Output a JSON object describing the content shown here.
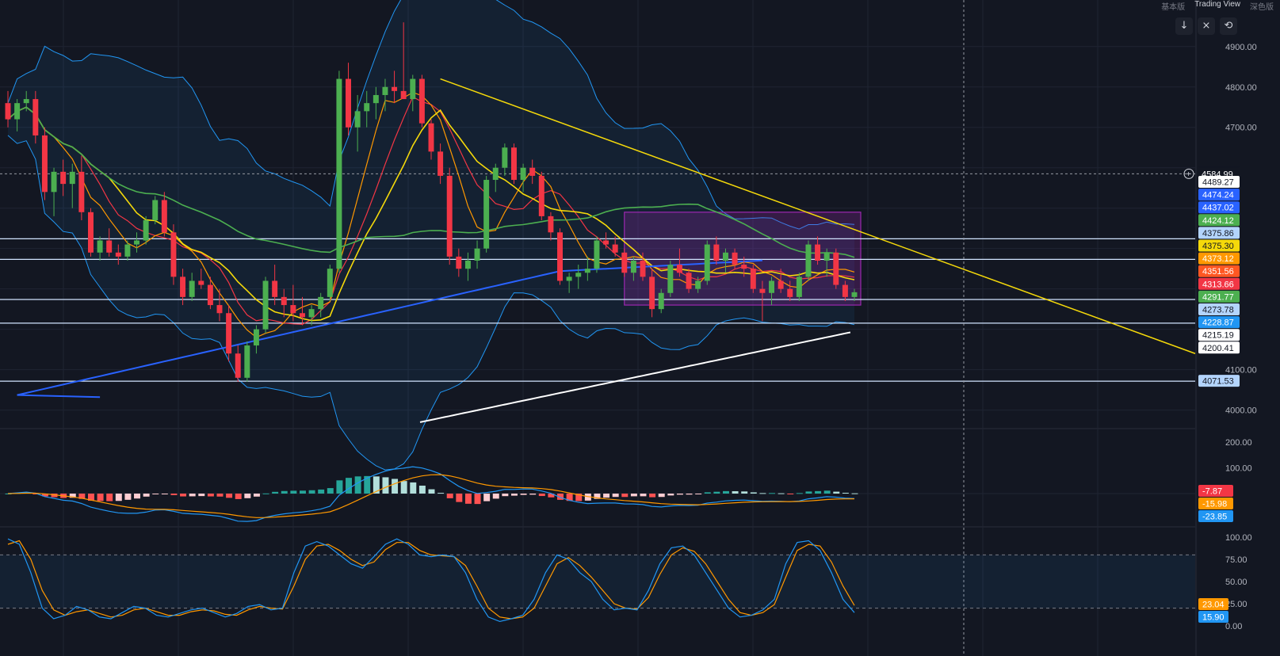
{
  "toolbar": {
    "buttons": [
      {
        "name": "scroll-down-button",
        "glyph": "↓"
      },
      {
        "name": "collapse-button",
        "glyph": "⨯"
      },
      {
        "name": "reset-button",
        "glyph": "⟲"
      }
    ],
    "brand_items": [
      "基本版",
      "Trading View",
      "深色版"
    ]
  },
  "colors": {
    "background": "#131722",
    "grid": "#1f2433",
    "up": "#4caf50",
    "down": "#f23645",
    "ma_yellow": "#f5d90a",
    "ma_orange": "#ff9800",
    "ma_green": "#4caf50",
    "ma_blue": "#2962ff",
    "ma_white": "#ffffff",
    "bollinger": "#2196f3",
    "trendline": "#f5d90a",
    "range_box": "#9c27b0"
  },
  "chart_data": [
    {
      "type": "candlestick",
      "panel": "price",
      "ylim": [
        3960,
        4980
      ],
      "y_ticks": [
        "4900.00",
        "4800.00",
        "4700.00",
        "4584.99",
        "4100.00",
        "4000.00"
      ],
      "crosshair_price": "4584.99",
      "horizontal_levels": [
        4424.12,
        4373.12,
        4273.78,
        4215.19,
        4071.53
      ],
      "price_labels": [
        {
          "value": "4489.27",
          "color": "#ffffff",
          "text_color": "#131722"
        },
        {
          "value": "4474.24",
          "color": "#2962ff",
          "text_color": "#ffffff"
        },
        {
          "value": "4437.02",
          "color": "#2962ff",
          "text_color": "#ffffff"
        },
        {
          "value": "4424.12",
          "color": "#4caf50",
          "text_color": "#ffffff"
        },
        {
          "value": "4375.86",
          "color": "#b3d4fc",
          "text_color": "#131722"
        },
        {
          "value": "4375.30",
          "color": "#f5d90a",
          "text_color": "#131722"
        },
        {
          "value": "4373.12",
          "color": "#ff9800",
          "text_color": "#ffffff"
        },
        {
          "value": "4351.56",
          "color": "#ff5722",
          "text_color": "#ffffff"
        },
        {
          "value": "4313.66",
          "color": "#f23645",
          "text_color": "#ffffff"
        },
        {
          "value": "4291.77",
          "color": "#4caf50",
          "text_color": "#ffffff"
        },
        {
          "value": "4273.78",
          "color": "#b3d4fc",
          "text_color": "#131722"
        },
        {
          "value": "4228.87",
          "color": "#2196f3",
          "text_color": "#ffffff"
        },
        {
          "value": "4215.19",
          "color": "#ffffff",
          "text_color": "#131722"
        },
        {
          "value": "4200.41",
          "color": "#ffffff",
          "text_color": "#131722"
        },
        {
          "value": "4071.53",
          "color": "#b3d4fc",
          "text_color": "#131722"
        }
      ],
      "ohlc": [
        [
          4760,
          4790,
          4700,
          4720
        ],
        [
          4720,
          4770,
          4690,
          4760
        ],
        [
          4760,
          4790,
          4740,
          4770
        ],
        [
          4770,
          4790,
          4660,
          4680
        ],
        [
          4680,
          4700,
          4520,
          4540
        ],
        [
          4540,
          4600,
          4480,
          4590
        ],
        [
          4590,
          4620,
          4530,
          4560
        ],
        [
          4560,
          4610,
          4500,
          4590
        ],
        [
          4590,
          4630,
          4470,
          4490
        ],
        [
          4490,
          4500,
          4380,
          4390
        ],
        [
          4390,
          4430,
          4370,
          4420
        ],
        [
          4420,
          4450,
          4380,
          4390
        ],
        [
          4390,
          4410,
          4360,
          4380
        ],
        [
          4380,
          4420,
          4370,
          4410
        ],
        [
          4410,
          4440,
          4390,
          4420
        ],
        [
          4420,
          4480,
          4410,
          4470
        ],
        [
          4470,
          4530,
          4460,
          4520
        ],
        [
          4520,
          4540,
          4430,
          4440
        ],
        [
          4440,
          4460,
          4310,
          4330
        ],
        [
          4330,
          4350,
          4260,
          4280
        ],
        [
          4280,
          4340,
          4270,
          4320
        ],
        [
          4320,
          4350,
          4300,
          4310
        ],
        [
          4310,
          4330,
          4250,
          4260
        ],
        [
          4260,
          4300,
          4220,
          4240
        ],
        [
          4240,
          4260,
          4120,
          4140
        ],
        [
          4140,
          4160,
          4070,
          4080
        ],
        [
          4080,
          4170,
          4070,
          4160
        ],
        [
          4160,
          4210,
          4140,
          4200
        ],
        [
          4200,
          4330,
          4190,
          4320
        ],
        [
          4320,
          4360,
          4260,
          4280
        ],
        [
          4280,
          4300,
          4230,
          4260
        ],
        [
          4260,
          4310,
          4220,
          4240
        ],
        [
          4240,
          4280,
          4210,
          4230
        ],
        [
          4230,
          4260,
          4210,
          4250
        ],
        [
          4250,
          4290,
          4230,
          4280
        ],
        [
          4280,
          4360,
          4270,
          4350
        ],
        [
          4350,
          4840,
          4340,
          4820
        ],
        [
          4820,
          4860,
          4680,
          4700
        ],
        [
          4700,
          4780,
          4640,
          4740
        ],
        [
          4740,
          4790,
          4700,
          4760
        ],
        [
          4760,
          4800,
          4720,
          4780
        ],
        [
          4780,
          4820,
          4740,
          4800
        ],
        [
          4800,
          4840,
          4760,
          4790
        ],
        [
          4790,
          4960,
          4770,
          4770
        ],
        [
          4770,
          4830,
          4740,
          4820
        ],
        [
          4820,
          4830,
          4700,
          4710
        ],
        [
          4710,
          4720,
          4620,
          4640
        ],
        [
          4640,
          4660,
          4560,
          4580
        ],
        [
          4580,
          4600,
          4360,
          4380
        ],
        [
          4380,
          4400,
          4330,
          4350
        ],
        [
          4350,
          4390,
          4320,
          4370
        ],
        [
          4370,
          4420,
          4350,
          4400
        ],
        [
          4400,
          4580,
          4390,
          4570
        ],
        [
          4570,
          4610,
          4540,
          4600
        ],
        [
          4600,
          4660,
          4580,
          4650
        ],
        [
          4650,
          4660,
          4560,
          4570
        ],
        [
          4570,
          4610,
          4540,
          4600
        ],
        [
          4600,
          4620,
          4560,
          4580
        ],
        [
          4580,
          4590,
          4470,
          4480
        ],
        [
          4480,
          4490,
          4420,
          4440
        ],
        [
          4440,
          4450,
          4310,
          4320
        ],
        [
          4320,
          4340,
          4290,
          4330
        ],
        [
          4330,
          4360,
          4300,
          4340
        ],
        [
          4340,
          4380,
          4320,
          4350
        ],
        [
          4350,
          4430,
          4340,
          4420
        ],
        [
          4420,
          4440,
          4400,
          4410
        ],
        [
          4410,
          4430,
          4380,
          4390
        ],
        [
          4390,
          4400,
          4330,
          4340
        ],
        [
          4340,
          4380,
          4320,
          4370
        ],
        [
          4370,
          4390,
          4320,
          4330
        ],
        [
          4330,
          4350,
          4230,
          4250
        ],
        [
          4250,
          4300,
          4240,
          4290
        ],
        [
          4290,
          4370,
          4280,
          4360
        ],
        [
          4360,
          4400,
          4330,
          4340
        ],
        [
          4340,
          4350,
          4290,
          4300
        ],
        [
          4300,
          4330,
          4290,
          4320
        ],
        [
          4320,
          4420,
          4310,
          4410
        ],
        [
          4410,
          4430,
          4360,
          4370
        ],
        [
          4370,
          4400,
          4340,
          4390
        ],
        [
          4390,
          4400,
          4350,
          4360
        ],
        [
          4360,
          4380,
          4330,
          4350
        ],
        [
          4350,
          4360,
          4290,
          4300
        ],
        [
          4300,
          4320,
          4220,
          4290
        ],
        [
          4290,
          4330,
          4260,
          4320
        ],
        [
          4320,
          4350,
          4290,
          4300
        ],
        [
          4300,
          4320,
          4270,
          4280
        ],
        [
          4280,
          4340,
          4270,
          4330
        ],
        [
          4330,
          4420,
          4320,
          4410
        ],
        [
          4410,
          4430,
          4360,
          4370
        ],
        [
          4370,
          4400,
          4330,
          4390
        ],
        [
          4390,
          4400,
          4300,
          4310
        ],
        [
          4310,
          4320,
          4270,
          4280
        ],
        [
          4280,
          4300,
          4270,
          4291.77
        ]
      ]
    },
    {
      "type": "macd",
      "panel": "macd",
      "ylim": [
        -120,
        240
      ],
      "y_ticks": [
        "200.00",
        "100.00"
      ],
      "values_shown": {
        "histogram": "-7.87",
        "signal": "-15.98",
        "macd": "-23.85"
      },
      "label_colors": {
        "histogram": "#f23645",
        "signal": "#ff9800",
        "macd": "#2196f3"
      }
    },
    {
      "type": "stochastic",
      "panel": "stoch",
      "ylim": [
        0,
        100
      ],
      "y_ticks": [
        "100.00",
        "75.00",
        "50.00",
        "25.00",
        "0.00"
      ],
      "values_shown": {
        "d": "23.04",
        "k": "15.90"
      },
      "label_colors": {
        "d": "#ff9800",
        "k": "#2196f3"
      },
      "k": [
        98,
        92,
        60,
        20,
        8,
        12,
        22,
        18,
        10,
        8,
        15,
        22,
        20,
        12,
        10,
        14,
        18,
        20,
        15,
        10,
        14,
        22,
        24,
        18,
        20,
        60,
        90,
        95,
        90,
        80,
        70,
        65,
        78,
        92,
        98,
        92,
        80,
        78,
        80,
        78,
        60,
        30,
        10,
        5,
        8,
        12,
        30,
        60,
        80,
        75,
        60,
        50,
        30,
        18,
        20,
        18,
        40,
        70,
        88,
        90,
        80,
        60,
        40,
        20,
        10,
        12,
        18,
        30,
        70,
        94,
        96,
        85,
        60,
        30,
        15
      ],
      "d": [
        92,
        96,
        75,
        40,
        18,
        12,
        16,
        18,
        14,
        10,
        12,
        18,
        20,
        16,
        12,
        12,
        16,
        18,
        17,
        13,
        12,
        18,
        22,
        20,
        19,
        45,
        75,
        90,
        92,
        85,
        75,
        68,
        72,
        86,
        94,
        94,
        85,
        80,
        79,
        78,
        68,
        45,
        20,
        10,
        8,
        10,
        20,
        45,
        70,
        77,
        68,
        55,
        40,
        25,
        20,
        19,
        32,
        58,
        80,
        88,
        84,
        70,
        50,
        30,
        15,
        12,
        15,
        24,
        55,
        85,
        92,
        90,
        72,
        45,
        23
      ]
    }
  ]
}
